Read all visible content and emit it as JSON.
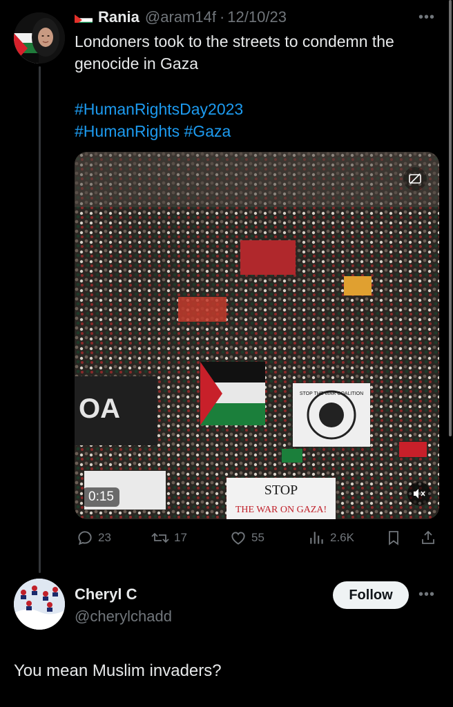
{
  "tweet": {
    "author_name": "Rania",
    "author_handle": "@aram14f",
    "separator": "·",
    "date": "12/10/23",
    "text": "Londoners took to the streets to condemn the genocide in Gaza",
    "hashtag_line_1": "#HumanRightsDay2023",
    "hashtag_line_2": "#HumanRights #Gaza",
    "media": {
      "duration": "0:15",
      "banner_stop": "STOP",
      "banner_war": "THE WAR ON GAZA!",
      "sign_oa": "OA",
      "sign_circle": "STOP THE WAR COALITION"
    },
    "stats": {
      "replies": "23",
      "reposts": "17",
      "likes": "55",
      "views": "2.6K"
    }
  },
  "reply": {
    "author_name": "Cheryl C",
    "author_handle": "@cherylchadd",
    "follow_label": "Follow",
    "text": "You mean Muslim invaders?"
  },
  "colors": {
    "background": "#000000",
    "accent": "#1d9bf0",
    "secondary_text": "#71767b",
    "primary_text": "#e7e9ea"
  },
  "icons": [
    "more-icon",
    "reply-icon",
    "repost-icon",
    "like-icon",
    "views-icon",
    "bookmark-icon",
    "share-icon",
    "mute-icon",
    "captions-icon"
  ]
}
